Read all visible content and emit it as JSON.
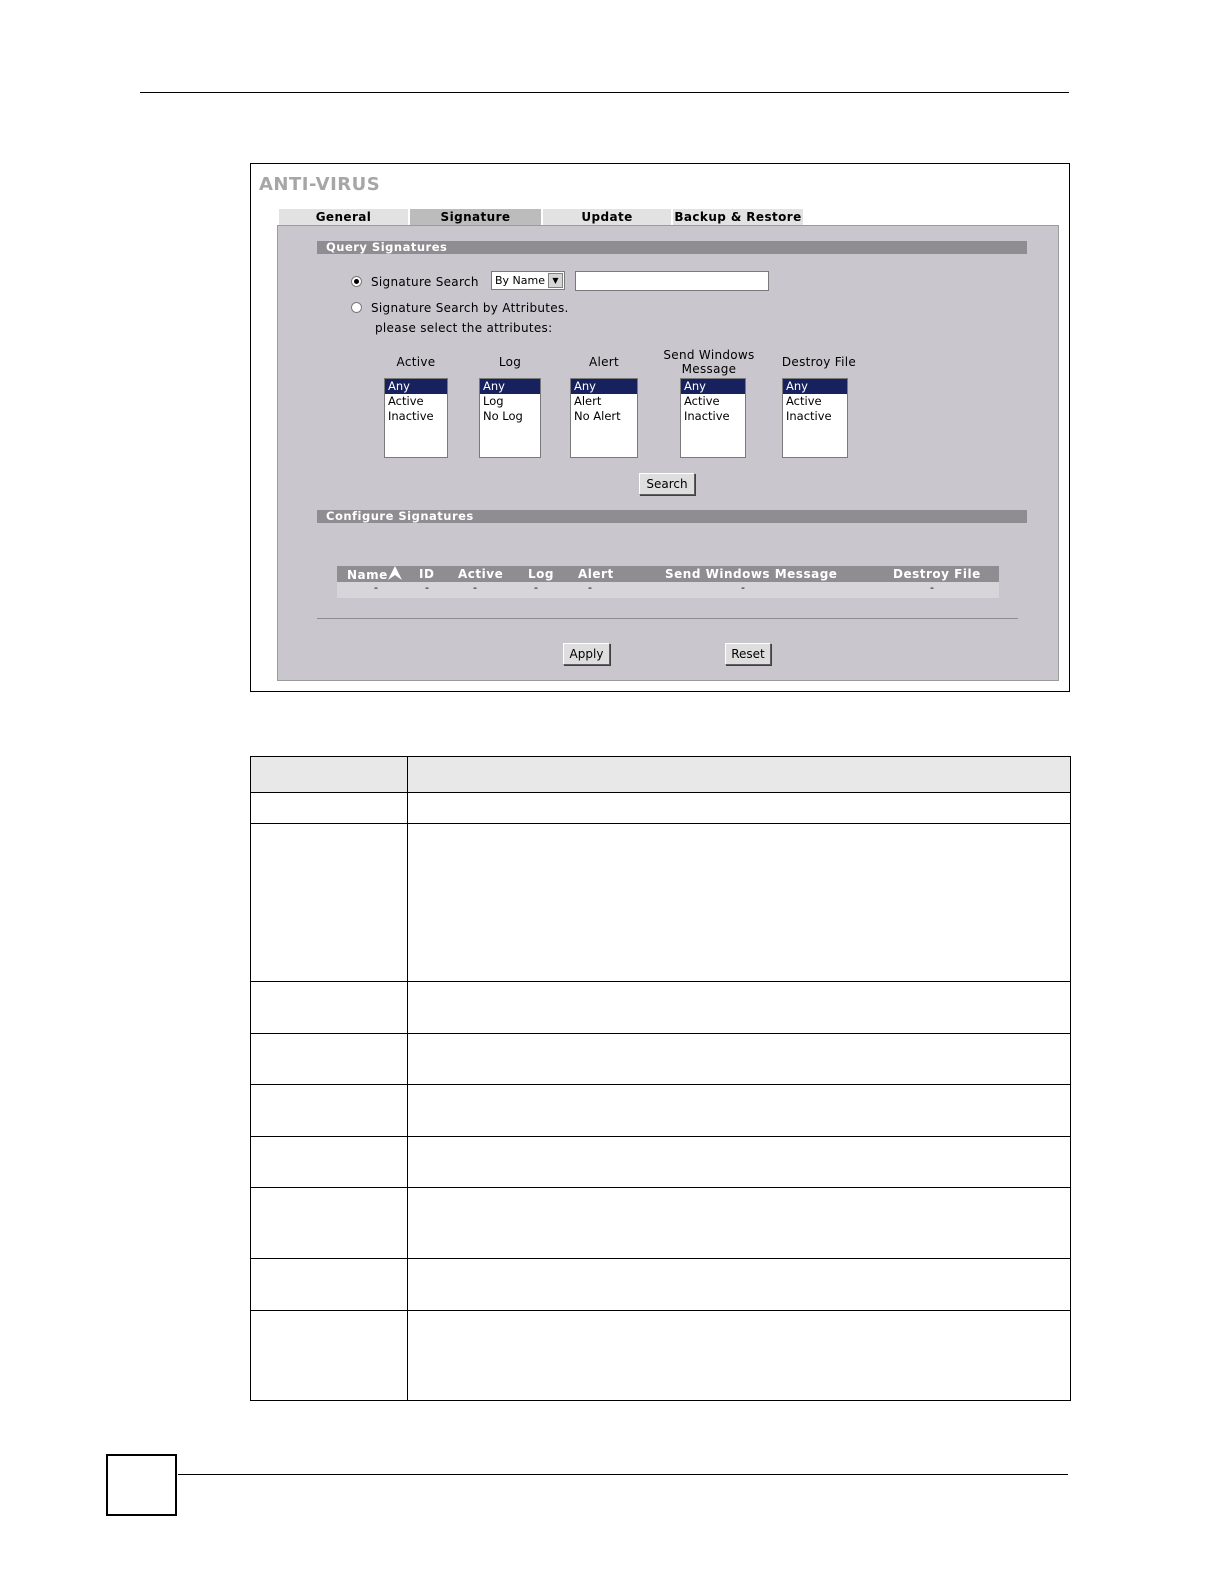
{
  "app": {
    "title": "ANTI-VIRUS",
    "tabs": [
      {
        "label": "General"
      },
      {
        "label": "Signature"
      },
      {
        "label": "Update"
      },
      {
        "label": "Backup & Restore"
      }
    ],
    "active_tab": "Signature"
  },
  "query": {
    "section_title": "Query Signatures",
    "radio_search_label": "Signature Search",
    "radio_search_selected": true,
    "search_type_value": "By Name",
    "search_text_value": "",
    "radio_attr_label": "Signature Search by Attributes.",
    "attr_hint": "please select the attributes:",
    "lists": [
      {
        "header": "Active",
        "options": [
          "Any",
          "Active",
          "Inactive"
        ],
        "selected": "Any"
      },
      {
        "header": "Log",
        "options": [
          "Any",
          "Log",
          "No Log"
        ],
        "selected": "Any"
      },
      {
        "header": "Alert",
        "options": [
          "Any",
          "Alert",
          "No Alert"
        ],
        "selected": "Any"
      },
      {
        "header_line1": "Send Windows",
        "header_line2": "Message",
        "options": [
          "Any",
          "Active",
          "Inactive"
        ],
        "selected": "Any"
      },
      {
        "header": "Destroy File",
        "options": [
          "Any",
          "Active",
          "Inactive"
        ],
        "selected": "Any"
      }
    ],
    "search_button": "Search"
  },
  "configure": {
    "section_title": "Configure Signatures",
    "columns": [
      "Name",
      "ID",
      "Active",
      "Log",
      "Alert",
      "Send Windows Message",
      "Destroy File"
    ],
    "row": [
      "-",
      "-",
      "-",
      "-",
      "-",
      "-",
      "-"
    ],
    "apply_button": "Apply",
    "reset_button": "Reset"
  },
  "icons": {
    "sort": "sort-ascending-icon",
    "dropdown": "chevron-down-icon"
  }
}
